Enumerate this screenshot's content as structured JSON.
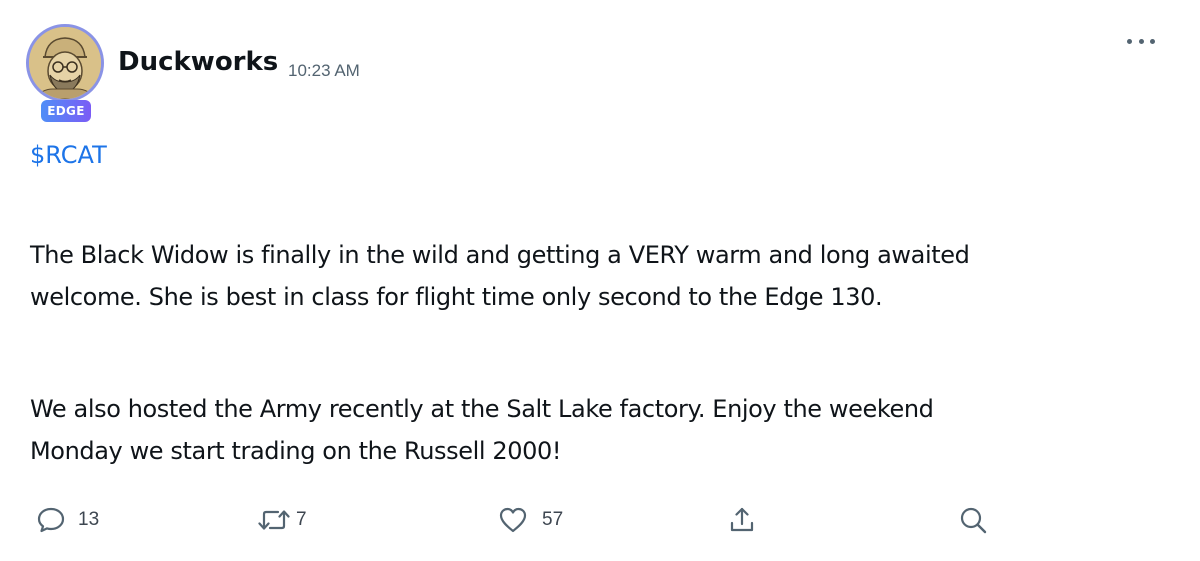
{
  "post": {
    "author": "Duckworks",
    "timestamp": "10:23 AM",
    "badge": "EDGE",
    "cashtag": "$RCAT",
    "body": {
      "p1_line1": "The Black Widow is finally in the wild and getting a VERY warm and long awaited",
      "p1_line2": "welcome. She is best in class for flight time only second to the Edge 130.",
      "p2_line1": "We also hosted the Army recently at the Salt Lake factory.  Enjoy the weekend",
      "p2_line2": "Monday we start trading on the Russell 2000!"
    }
  },
  "actions": {
    "reply": {
      "icon": "comment-icon",
      "count": "13"
    },
    "repost": {
      "icon": "repost-icon",
      "count": "7"
    },
    "like": {
      "icon": "heart-icon",
      "count": "57"
    },
    "share": {
      "icon": "share-icon"
    },
    "search": {
      "icon": "search-icon"
    }
  },
  "colors": {
    "cashtag": "#1d74e8",
    "badge_start": "#4f8ef7",
    "badge_end": "#7b5cf5",
    "avatar_ring": "#8a93e6",
    "icon": "#536471"
  }
}
